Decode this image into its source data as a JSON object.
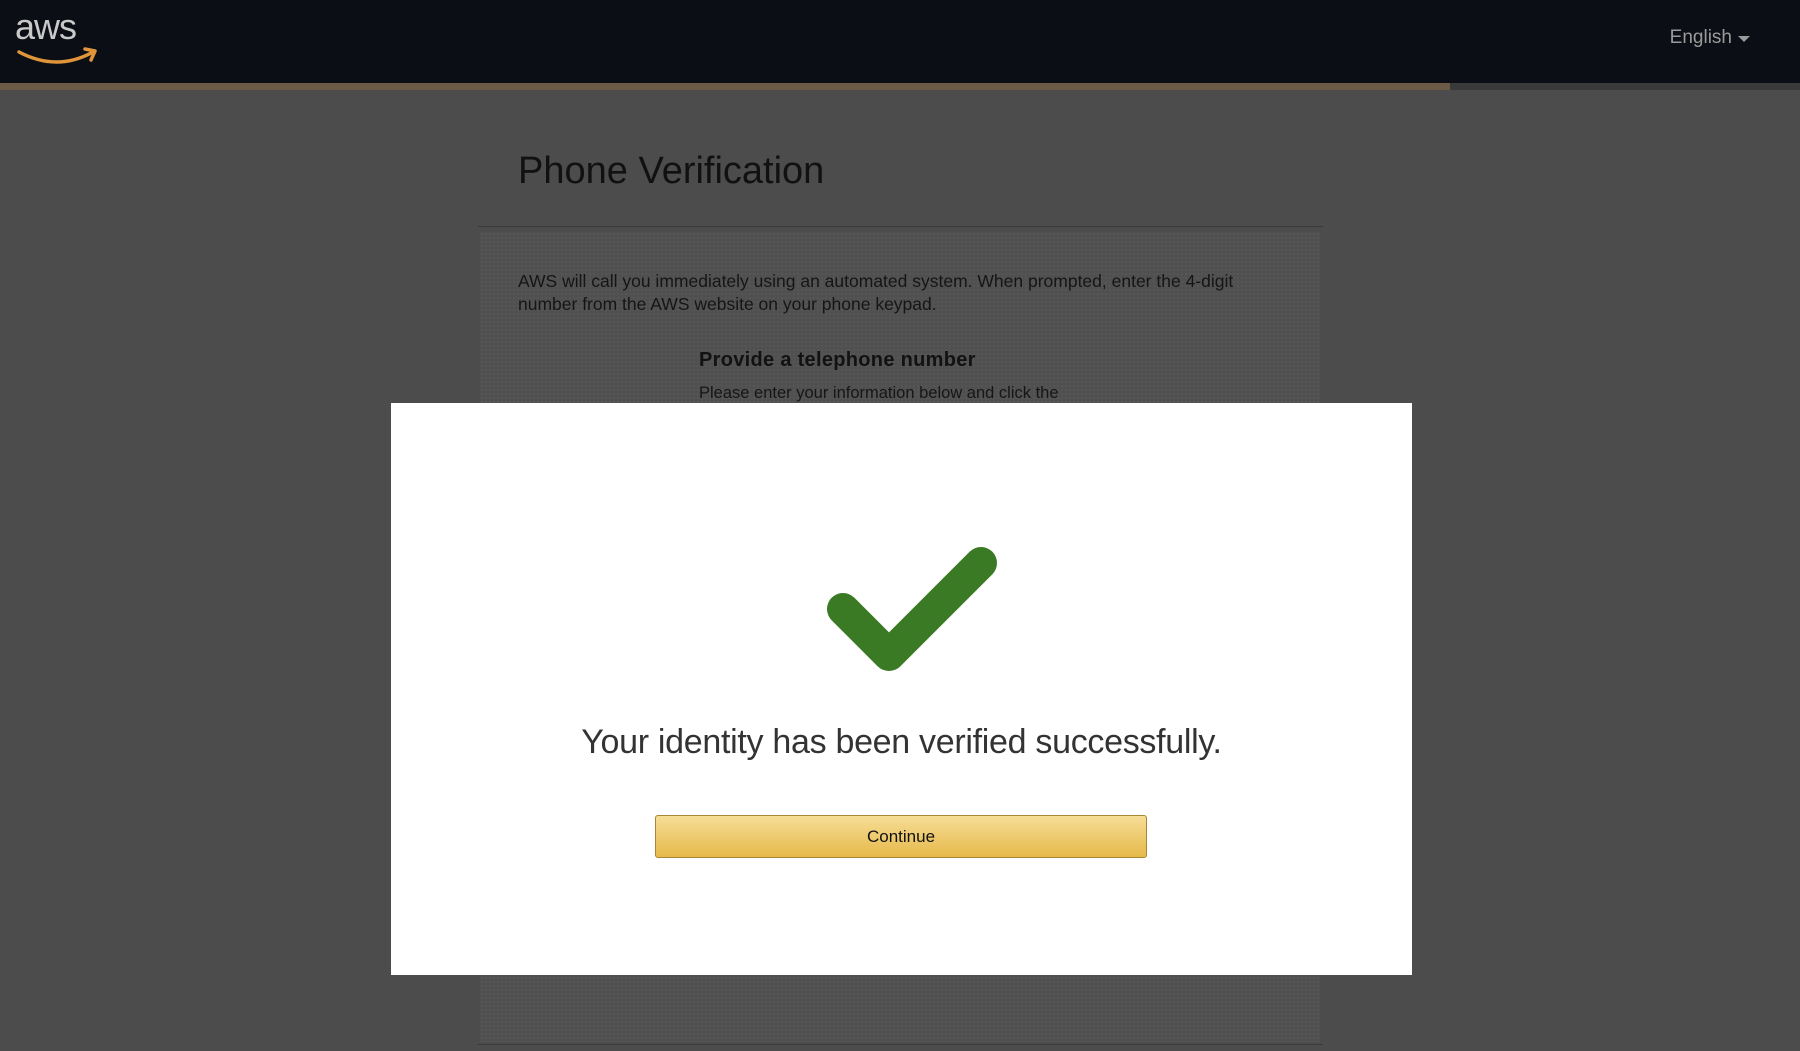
{
  "header": {
    "logo_text": "aws",
    "language_label": "English",
    "colors": {
      "background": "#0b0e14",
      "accent_bar": "#6b5a45"
    }
  },
  "page": {
    "title": "Phone Verification",
    "intro_text": "AWS will call you immediately using an automated system. When prompted, enter the 4-digit number from the AWS website on your phone keypad.",
    "section_heading": "Provide a telephone number",
    "section_text": "Please enter your information below and click the"
  },
  "modal": {
    "icon": "check-icon",
    "message": "Your identity has been verified successfully.",
    "continue_label": "Continue",
    "colors": {
      "check": "#3b7a24",
      "button_top": "#f6dd96",
      "button_bottom": "#e6b94a"
    }
  }
}
